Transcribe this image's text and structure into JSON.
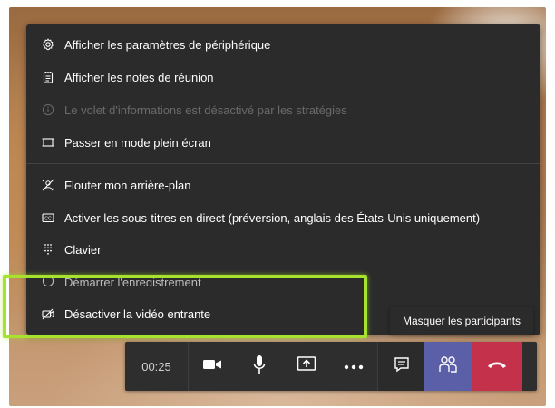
{
  "menu": {
    "items": [
      {
        "label": "Afficher les paramètres de périphérique",
        "icon": "gear-icon",
        "enabled": true
      },
      {
        "label": "Afficher les notes de réunion",
        "icon": "notes-icon",
        "enabled": true
      },
      {
        "label": "Le volet d'informations est désactivé par les stratégies",
        "icon": "info-icon",
        "enabled": false
      },
      {
        "label": "Passer en mode plein écran",
        "icon": "fullscreen-icon",
        "enabled": true
      },
      {
        "label": "Flouter mon arrière-plan",
        "icon": "blur-background-icon",
        "enabled": true
      },
      {
        "label": "Activer les sous-titres en direct (préversion, anglais des États-Unis uniquement)",
        "icon": "captions-icon",
        "enabled": true
      },
      {
        "label": "Clavier",
        "icon": "keypad-icon",
        "enabled": true
      },
      {
        "label": "Démarrer l'enregistrement",
        "icon": "record-icon",
        "enabled": true
      },
      {
        "label": "Désactiver la vidéo entrante",
        "icon": "video-off-icon",
        "enabled": true
      }
    ]
  },
  "tooltip": {
    "text": "Masquer les participants"
  },
  "toolbar": {
    "timer": "00:25",
    "buttons": [
      {
        "name": "camera",
        "icon": "camera-icon"
      },
      {
        "name": "microphone",
        "icon": "microphone-icon"
      },
      {
        "name": "share",
        "icon": "share-screen-icon"
      },
      {
        "name": "more",
        "icon": "more-icon"
      },
      {
        "name": "chat",
        "icon": "chat-icon"
      },
      {
        "name": "participants",
        "icon": "participants-icon"
      },
      {
        "name": "hangup",
        "icon": "hang-up-icon"
      }
    ]
  },
  "colors": {
    "menu_bg": "#2b2b2b",
    "highlight": "#a6e22e",
    "participants_active": "#5b5fa7",
    "hangup": "#c4314b"
  }
}
